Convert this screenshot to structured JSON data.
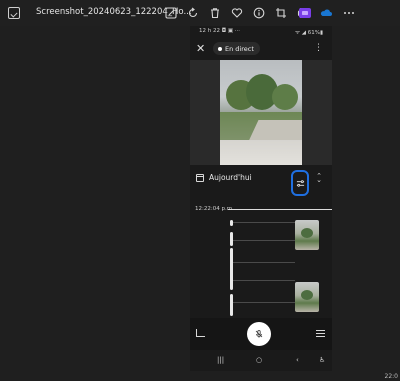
{
  "window": {
    "title": "Screenshot_20240623_122204_Ho...",
    "toolbar_icons": [
      "edit-image-icon",
      "rotate-icon",
      "delete-icon",
      "favorite-icon",
      "info-icon",
      "crop-icon",
      "print-icon",
      "clipchamp-icon",
      "onedrive-icon",
      "more-icon"
    ],
    "toolbar_glyphs": [
      "✎",
      "↻",
      "🗑",
      "♡",
      "ⓘ",
      "▭",
      "⎙",
      "■",
      "☁",
      "⋯"
    ],
    "clock": "22:0"
  },
  "phone": {
    "status": {
      "time": "12 h 22 ◘ ▣ ···",
      "battery": "ᯤ ◢ 61%▮"
    },
    "header": {
      "close": "✕",
      "live_label": "En direct",
      "menu": "⋮"
    },
    "today_label": "Aujourd'hui",
    "timeline": {
      "timestamp": "12:22:04 p.m."
    },
    "nav": {
      "recents": "|||",
      "home": "○",
      "back": "‹",
      "accessibility": "♿"
    }
  },
  "colors": {
    "highlight": "#1f6fe0",
    "background": "#1f1f1f"
  }
}
